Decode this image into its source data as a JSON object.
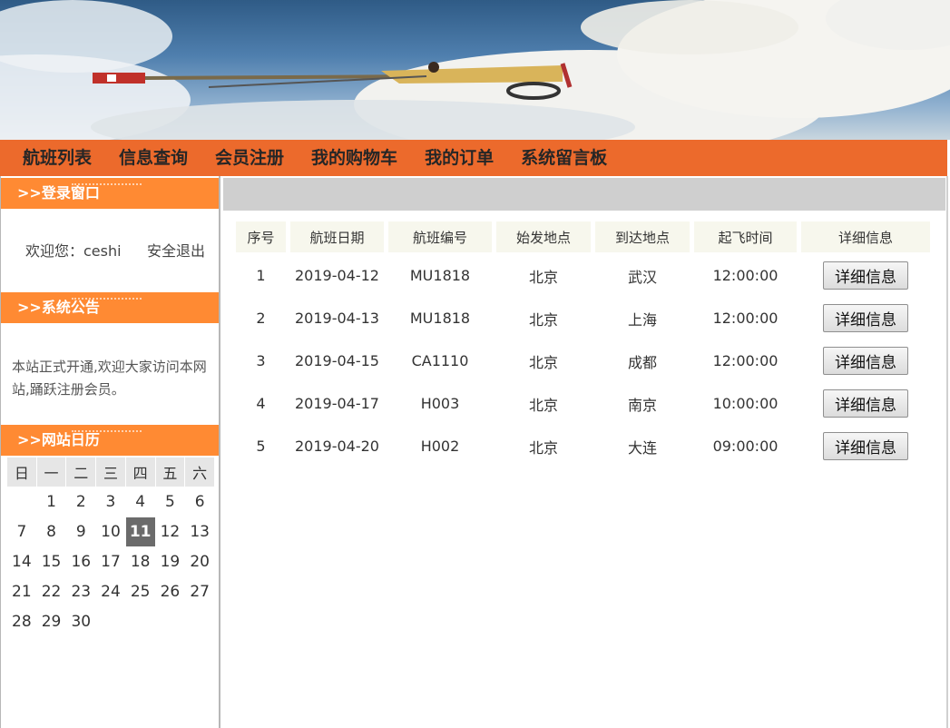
{
  "nav": {
    "items": [
      "航班列表",
      "信息查询",
      "会员注册",
      "我的购物车",
      "我的订单",
      "系统留言板"
    ]
  },
  "sidebar": {
    "login": {
      "title": ">>登录窗口",
      "welcome": "欢迎您：ceshi",
      "logout": "安全退出"
    },
    "notice": {
      "title": ">>系统公告",
      "text": "本站正式开通,欢迎大家访问本网站,踊跃注册会员。"
    },
    "calendar": {
      "title": ">>网站日历",
      "weekdays": [
        "日",
        "一",
        "二",
        "三",
        "四",
        "五",
        "六"
      ],
      "weeks": [
        [
          "",
          "1",
          "2",
          "3",
          "4",
          "5",
          "6"
        ],
        [
          "7",
          "8",
          "9",
          "10",
          "11",
          "12",
          "13"
        ],
        [
          "14",
          "15",
          "16",
          "17",
          "18",
          "19",
          "20"
        ],
        [
          "21",
          "22",
          "23",
          "24",
          "25",
          "26",
          "27"
        ],
        [
          "28",
          "29",
          "30",
          "",
          "",
          "",
          ""
        ]
      ],
      "today": "11"
    }
  },
  "table": {
    "headers": [
      "序号",
      "航班日期",
      "航班编号",
      "始发地点",
      "到达地点",
      "起飞时间",
      "详细信息"
    ],
    "detail_label": "详细信息",
    "rows": [
      [
        "1",
        "2019-04-12",
        "MU1818",
        "北京",
        "武汉",
        "12:00:00"
      ],
      [
        "2",
        "2019-04-13",
        "MU1818",
        "北京",
        "上海",
        "12:00:00"
      ],
      [
        "3",
        "2019-04-15",
        "CA1110",
        "北京",
        "成都",
        "12:00:00"
      ],
      [
        "4",
        "2019-04-17",
        "H003",
        "北京",
        "南京",
        "10:00:00"
      ],
      [
        "5",
        "2019-04-20",
        "H002",
        "北京",
        "大连",
        "09:00:00"
      ]
    ]
  },
  "colors": {
    "nav_bg": "#ec6a2c",
    "side_head_bg": "#ff8a33",
    "header_cell_bg": "#f7f7ed",
    "main_bar_bg": "#cfcfcf"
  }
}
